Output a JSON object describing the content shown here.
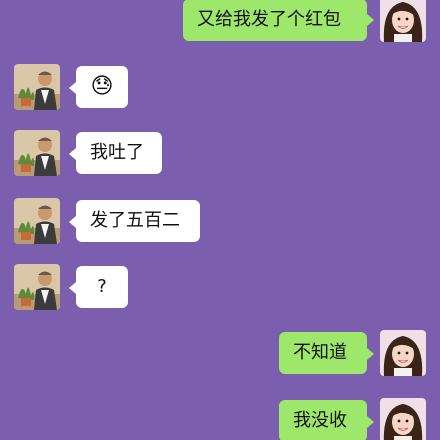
{
  "colors": {
    "background": "#7b5fae",
    "incoming_bubble": "#ffffff",
    "outgoing_bubble": "#9de86a"
  },
  "messages": [
    {
      "side": "right",
      "text": "又给我发了个红包",
      "avatar": "girl-avatar"
    },
    {
      "side": "left",
      "text": "😓",
      "avatar": "old-man-avatar"
    },
    {
      "side": "left",
      "text": "我吐了",
      "avatar": "old-man-avatar"
    },
    {
      "side": "left",
      "text": "发了五百二",
      "avatar": "old-man-avatar"
    },
    {
      "side": "left",
      "text": "?",
      "avatar": "old-man-avatar"
    },
    {
      "side": "right",
      "text": "不知道",
      "avatar": "girl-avatar"
    },
    {
      "side": "right",
      "text": "我没收",
      "avatar": "girl-avatar"
    }
  ]
}
